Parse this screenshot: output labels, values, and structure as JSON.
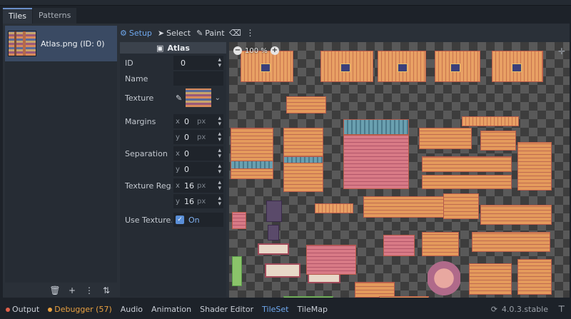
{
  "tabs": [
    {
      "label": "Tiles",
      "active": true
    },
    {
      "label": "Patterns",
      "active": false
    }
  ],
  "atlas_list": {
    "items": [
      {
        "label": "Atlas.png (ID: 0)",
        "selected": true
      }
    ],
    "toolbar_icons": [
      "trash-icon",
      "add-icon",
      "more-vertical-icon",
      "sort-icon"
    ]
  },
  "modes": {
    "setup": "Setup",
    "select": "Select",
    "paint": "Paint"
  },
  "inspector": {
    "header": "Atlas",
    "id_label": "ID",
    "id_value": "0",
    "name_label": "Name",
    "name_value": "",
    "texture_label": "Texture",
    "margins_label": "Margins",
    "margins": {
      "x": "0",
      "y": "0",
      "unit": "px"
    },
    "separation_label": "Separation",
    "separation": {
      "x": "0",
      "y": "0"
    },
    "region_label": "Texture Reg...",
    "region": {
      "x": "16",
      "y": "16",
      "unit": "px"
    },
    "use_texture_label": "Use Texture...",
    "use_texture_value": "On",
    "axis_x": "x",
    "axis_y": "y"
  },
  "canvas": {
    "zoom": "100 %"
  },
  "bottom_bar": {
    "items": [
      {
        "label": "Output",
        "dot": "#e0604a"
      },
      {
        "label": "Debugger (57)",
        "dot": "#e8a040",
        "color": "#e8a040"
      },
      {
        "label": "Audio"
      },
      {
        "label": "Animation"
      },
      {
        "label": "Shader Editor"
      },
      {
        "label": "TileSet",
        "active": true
      },
      {
        "label": "TileMap"
      }
    ],
    "version": "4.0.3.stable"
  },
  "colors": {
    "accent": "#6fa8ee",
    "selection": "#3a4a63",
    "panel": "#262c34"
  }
}
